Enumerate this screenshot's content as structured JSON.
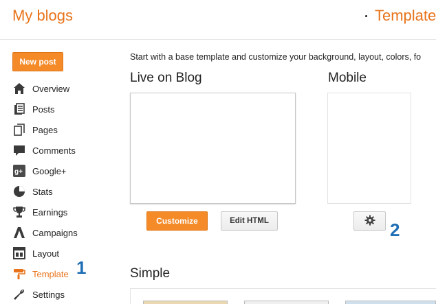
{
  "header": {
    "app_title": "My blogs",
    "page_title": "Template"
  },
  "sidebar": {
    "new_post_label": "New post",
    "items": [
      {
        "label": "Overview",
        "icon": "home-icon"
      },
      {
        "label": "Posts",
        "icon": "posts-icon"
      },
      {
        "label": "Pages",
        "icon": "pages-icon"
      },
      {
        "label": "Comments",
        "icon": "comment-icon"
      },
      {
        "label": "Google+",
        "icon": "google-plus-icon"
      },
      {
        "label": "Stats",
        "icon": "stats-icon"
      },
      {
        "label": "Earnings",
        "icon": "trophy-icon"
      },
      {
        "label": "Campaigns",
        "icon": "adwords-icon"
      },
      {
        "label": "Layout",
        "icon": "layout-icon"
      },
      {
        "label": "Template",
        "icon": "paint-roller-icon",
        "active": true
      },
      {
        "label": "Settings",
        "icon": "wrench-icon"
      }
    ]
  },
  "annotations": {
    "marker_1": "1",
    "marker_2": "2"
  },
  "main": {
    "intro_text": "Start with a base template and customize your background, layout, colors, fo",
    "live_heading": "Live on Blog",
    "mobile_heading": "Mobile",
    "customize_label": "Customize",
    "edit_html_label": "Edit HTML",
    "simple_heading": "Simple"
  },
  "colors": {
    "accent": "#e8731a",
    "button_orange": "#f48a28",
    "marker_blue": "#1f6fb5"
  }
}
